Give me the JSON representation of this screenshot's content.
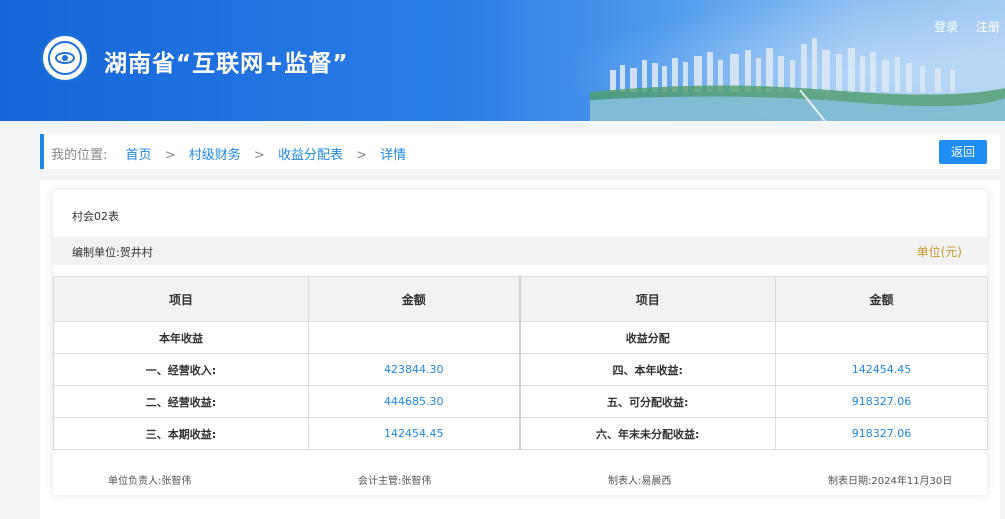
{
  "header": {
    "title": "湖南省“互联网+监督”",
    "login": "登录",
    "register": "注册",
    "logo_icon": "eye-seal-logo-icon"
  },
  "breadcrumb": {
    "label": "我的位置:",
    "items": [
      "首页",
      "村级财务",
      "收益分配表",
      "详情"
    ],
    "separator": ">",
    "back_label": "返回"
  },
  "report": {
    "form_code": "村会02表",
    "unit": "编制单位:贺井村",
    "currency_unit": "单位(元)",
    "columns": [
      "项目",
      "金额",
      "项目",
      "金额"
    ],
    "rows": [
      {
        "left_item": "本年收益",
        "left_amount": "",
        "right_item": "收益分配",
        "right_amount": ""
      },
      {
        "left_item": "一、经营收入:",
        "left_amount": "423844.30",
        "right_item": "四、本年收益:",
        "right_amount": "142454.45"
      },
      {
        "left_item": "二、经营收益:",
        "left_amount": "444685.30",
        "right_item": "五、可分配收益:",
        "right_amount": "918327.06"
      },
      {
        "left_item": "三、本期收益:",
        "left_amount": "142454.45",
        "right_item": "六、年末未分配收益:",
        "right_amount": "918327.06"
      }
    ],
    "signatures": {
      "head": "单位负责人:张智伟",
      "accountant": "会计主管:张智伟",
      "preparer": "制表人:易晨西",
      "date": "制表日期:2024年11月30日"
    }
  },
  "colors": {
    "accent": "#1e88e5",
    "unit_text": "#c99a2e",
    "header_blue": "#1565d8"
  }
}
